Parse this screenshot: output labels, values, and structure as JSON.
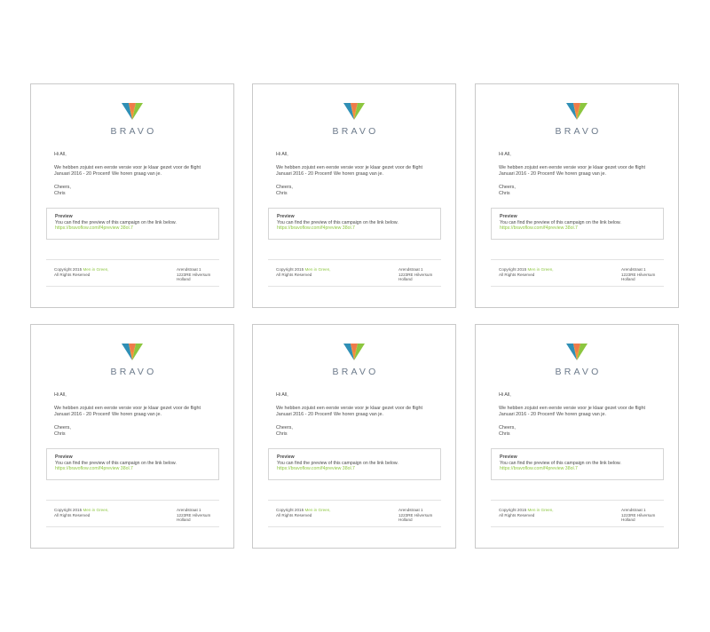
{
  "email": {
    "brand": "BRAVO",
    "greeting": "Hi All,",
    "message_line1": "We hebben zojuist een eerste versie voor je klaar gezet voor de flight",
    "message_line2": "Januari 2016 - 20 Procent! We horen graag van je.",
    "signoff": "Cheers,",
    "signature": "Chris",
    "preview_title": "Preview",
    "preview_text": "You can find the preview of this campaign on the link below.",
    "preview_link": "https://bravoflow.com/f4preview 38ol.7",
    "copyright_prefix": "Copyright 2015",
    "copyright_company": "Men in Green,",
    "rights": "All Rights Reserved",
    "address_line1": "Arendstraat 1",
    "address_line2": "1223RE Hilversum",
    "address_line3": "Holland"
  },
  "colors": {
    "accent_green": "#8cc63f",
    "logo_blue": "#2f8fb5",
    "logo_orange": "#f5913b",
    "logo_grey": "#6d7b8c"
  },
  "icons": {
    "logo": "bravo-v-logo-icon"
  }
}
